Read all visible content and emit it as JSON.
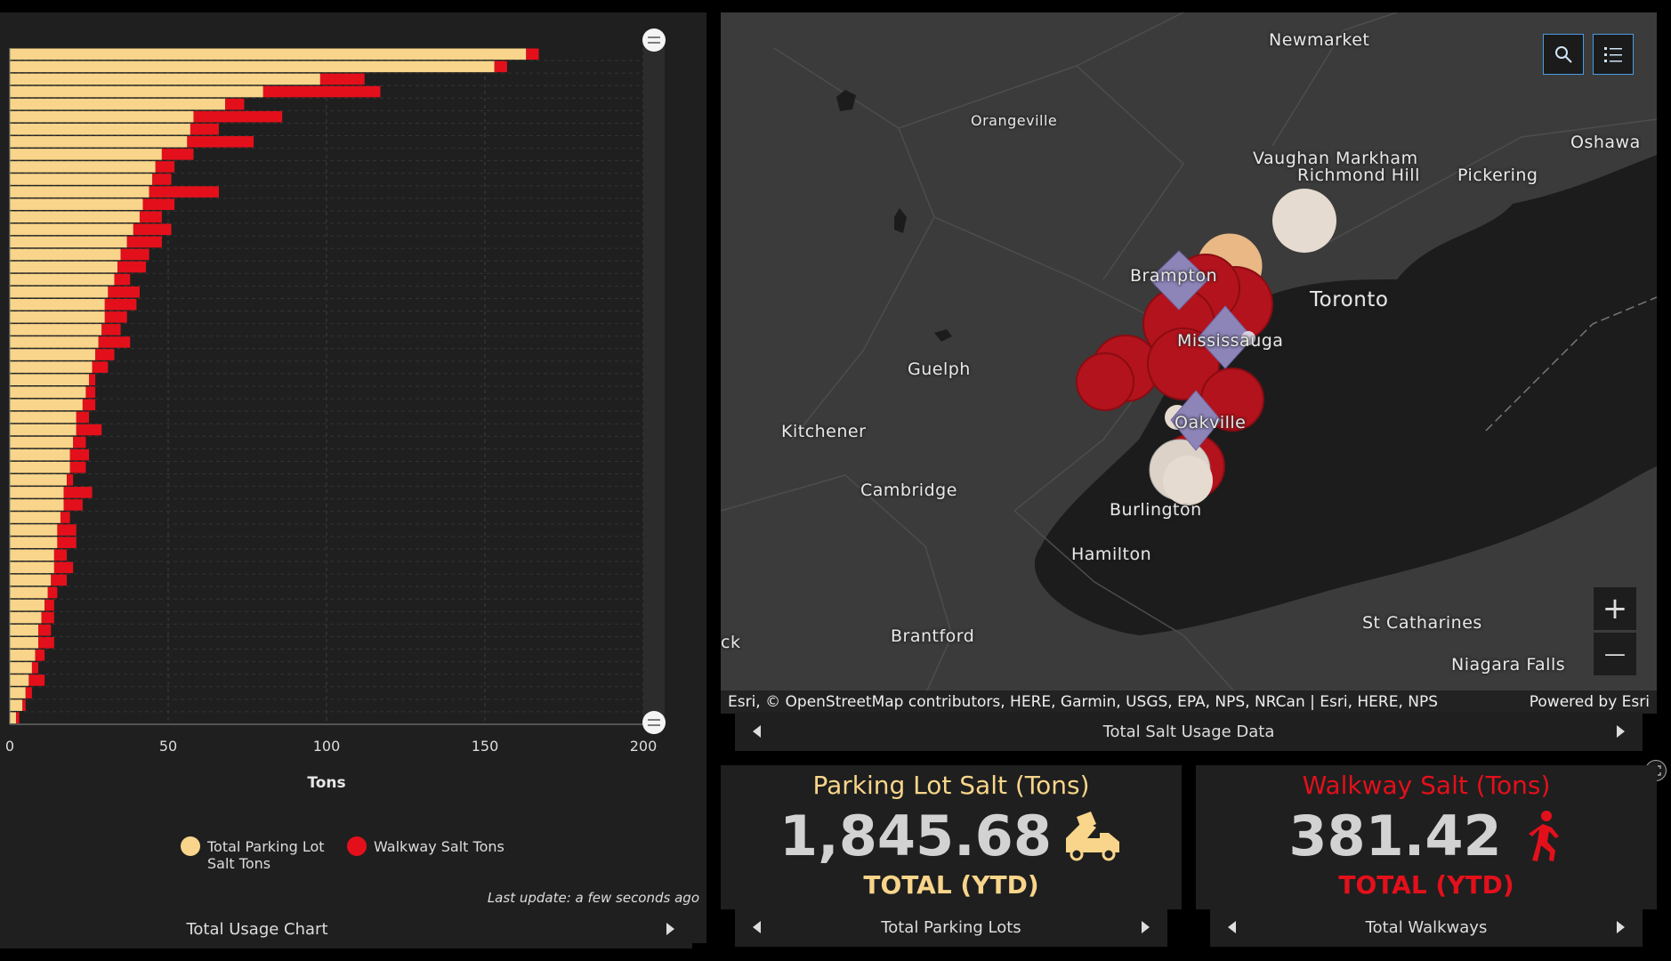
{
  "chart": {
    "axis_title": "Tons",
    "x_ticks": [
      "0",
      "50",
      "100",
      "150",
      "200"
    ],
    "legend": [
      {
        "label_line1": "Total Parking Lot",
        "label_line2": "Salt Tons",
        "color": "#f8d58a"
      },
      {
        "label_line1": "Walkway Salt Tons",
        "label_line2": "",
        "color": "#e3101b"
      }
    ],
    "last_update": "Last update: a few seconds ago",
    "footer_label": "Total Usage Chart"
  },
  "chart_data": {
    "type": "bar",
    "orientation": "horizontal",
    "stacked": true,
    "xlabel": "Tons",
    "xlim": [
      0,
      200
    ],
    "grid": true,
    "legend_position": "bottom",
    "series": [
      {
        "name": "Total Parking Lot Salt Tons",
        "color": "#f8d58a",
        "values": [
          163,
          153,
          98,
          80,
          68,
          58,
          57,
          56,
          48,
          46,
          45,
          44,
          42,
          41,
          39,
          37,
          35,
          34,
          33,
          31,
          30,
          30,
          29,
          28,
          27,
          26,
          25,
          24,
          23,
          21,
          21,
          20,
          19,
          19,
          18,
          17,
          17,
          16,
          15,
          15,
          14,
          14,
          13,
          12,
          11,
          10,
          9,
          9,
          8,
          7,
          6,
          5,
          4,
          2
        ]
      },
      {
        "name": "Walkway Salt Tons",
        "color": "#e3101b",
        "values": [
          4,
          4,
          14,
          37,
          6,
          28,
          9,
          21,
          10,
          6,
          6,
          22,
          10,
          7,
          12,
          11,
          9,
          9,
          5,
          10,
          10,
          7,
          6,
          10,
          6,
          5,
          2,
          3,
          4,
          4,
          8,
          4,
          6,
          5,
          2,
          9,
          6,
          3,
          6,
          6,
          4,
          6,
          5,
          3,
          3,
          4,
          4,
          5,
          3,
          2,
          5,
          2,
          1,
          1
        ]
      }
    ]
  },
  "map": {
    "labels": [
      "Newmarket",
      "Orangeville",
      "Vaughan  Markham",
      "Richmond Hill",
      "Oshawa",
      "Pickering",
      "Brampton",
      "Toronto",
      "Mississauga",
      "Guelph",
      "Kitchener",
      "Oakville",
      "Cambridge",
      "Burlington",
      "Hamilton",
      "Brantford",
      "St Catharines",
      "Niagara Falls",
      "ck"
    ],
    "attribution": "Esri, © OpenStreetMap contributors, HERE, Garmin, USGS, EPA, NPS, NRCan | Esri, HERE, NPS",
    "powered_by": "Powered by Esri",
    "zoom_in": "+",
    "zoom_out": "—",
    "footer_label": "Total Salt Usage Data"
  },
  "kpi_parking": {
    "title": "Parking Lot Salt (Tons)",
    "value": "1,845.68",
    "sub": "TOTAL (YTD)",
    "footer_label": "Total Parking Lots",
    "color": "#f8d58a"
  },
  "kpi_walkway": {
    "title": "Walkway Salt (Tons)",
    "value": "381.42",
    "sub": "TOTAL (YTD)",
    "footer_label": "Total Walkways",
    "color": "#e3101b"
  }
}
